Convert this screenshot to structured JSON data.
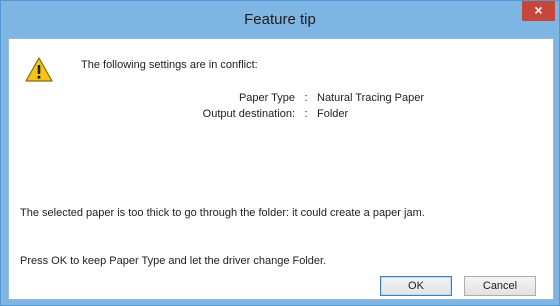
{
  "dialog": {
    "title": "Feature tip",
    "close_glyph": "×",
    "icon": "warning-icon",
    "heading": "The following settings are in conflict:",
    "settings": [
      {
        "key": "Paper Type",
        "sep": ":",
        "value": "Natural Tracing Paper"
      },
      {
        "key": "Output destination:",
        "sep": ":",
        "value": "Folder"
      }
    ],
    "message": "The selected paper is too thick to go through the folder: it could create a paper jam.",
    "instruction": "Press OK to keep Paper Type and let the driver change Folder.",
    "ok_label": "OK",
    "cancel_label": "Cancel"
  },
  "colors": {
    "titlebar": "#7fb5e3",
    "close": "#c7463b",
    "warning_fill": "#f6c21c"
  }
}
